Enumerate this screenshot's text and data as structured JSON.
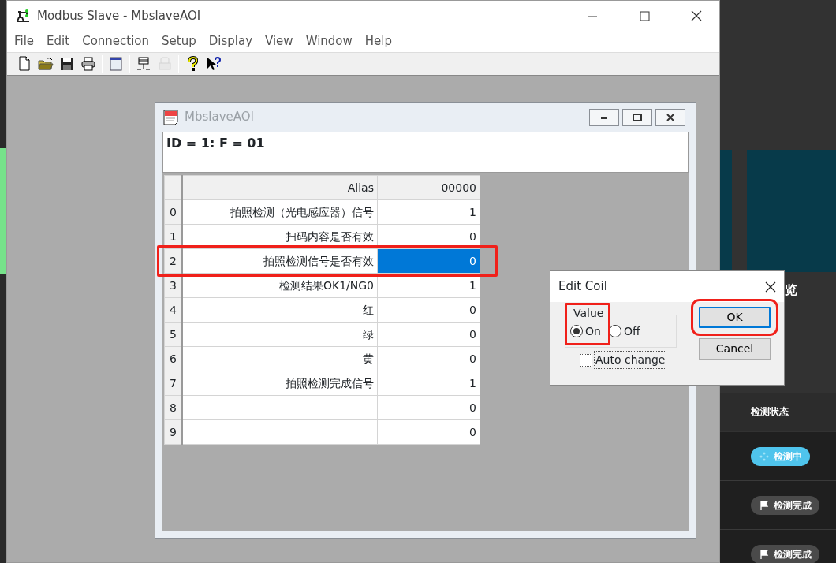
{
  "background_app": {
    "partial_title": "览",
    "table_header": "检测状态",
    "statuses": [
      {
        "label": "检测中",
        "kind": "active"
      },
      {
        "label": "检测完成",
        "kind": "done"
      },
      {
        "label": "检测完成",
        "kind": "done"
      }
    ]
  },
  "window": {
    "title": "Modbus Slave - MbslaveAOI"
  },
  "menu": [
    "File",
    "Edit",
    "Connection",
    "Setup",
    "Display",
    "View",
    "Window",
    "Help"
  ],
  "toolbar": [
    {
      "kind": "new",
      "disabled": false
    },
    {
      "kind": "open",
      "disabled": false
    },
    {
      "kind": "save",
      "disabled": false
    },
    {
      "kind": "print",
      "disabled": false
    },
    {
      "kind": "separator"
    },
    {
      "kind": "window",
      "disabled": false
    },
    {
      "kind": "separator"
    },
    {
      "kind": "connect",
      "disabled": false
    },
    {
      "kind": "disconnect",
      "disabled": true
    },
    {
      "kind": "separator"
    },
    {
      "kind": "help",
      "disabled": false
    },
    {
      "kind": "context_help",
      "disabled": false
    }
  ],
  "child_window": {
    "title": "MbslaveAOI",
    "header": "ID = 1: F = 01",
    "columns": [
      "Alias",
      "00000"
    ],
    "rows": [
      {
        "index": "0",
        "alias": "拍照检测（光电感应器）信号",
        "value": "1",
        "selected": false,
        "highlighted": false
      },
      {
        "index": "1",
        "alias": "扫码内容是否有效",
        "value": "0",
        "selected": false,
        "highlighted": false
      },
      {
        "index": "2",
        "alias": "拍照检测信号是否有效",
        "value": "0",
        "selected": true,
        "highlighted": true
      },
      {
        "index": "3",
        "alias": "检测结果OK1/NG0",
        "value": "1",
        "selected": false,
        "highlighted": false
      },
      {
        "index": "4",
        "alias": "红",
        "value": "0",
        "selected": false,
        "highlighted": false
      },
      {
        "index": "5",
        "alias": "绿",
        "value": "0",
        "selected": false,
        "highlighted": false
      },
      {
        "index": "6",
        "alias": "黄",
        "value": "0",
        "selected": false,
        "highlighted": false
      },
      {
        "index": "7",
        "alias": "拍照检测完成信号",
        "value": "1",
        "selected": false,
        "highlighted": false
      },
      {
        "index": "8",
        "value": "0",
        "selected": false,
        "highlighted": false
      },
      {
        "index": "9",
        "value": "0",
        "selected": false,
        "highlighted": false
      }
    ]
  },
  "dialog": {
    "title": "Edit Coil",
    "group_label": "Value",
    "value_marked": true,
    "options": [
      {
        "label": "On",
        "selected": true
      },
      {
        "label": "Off",
        "selected": false
      }
    ],
    "auto_change": {
      "label": "Auto change",
      "checked": false
    },
    "buttons": [
      {
        "label": "OK",
        "default": true,
        "highlighted": true
      },
      {
        "label": "Cancel",
        "default": false,
        "highlighted": false
      }
    ]
  }
}
